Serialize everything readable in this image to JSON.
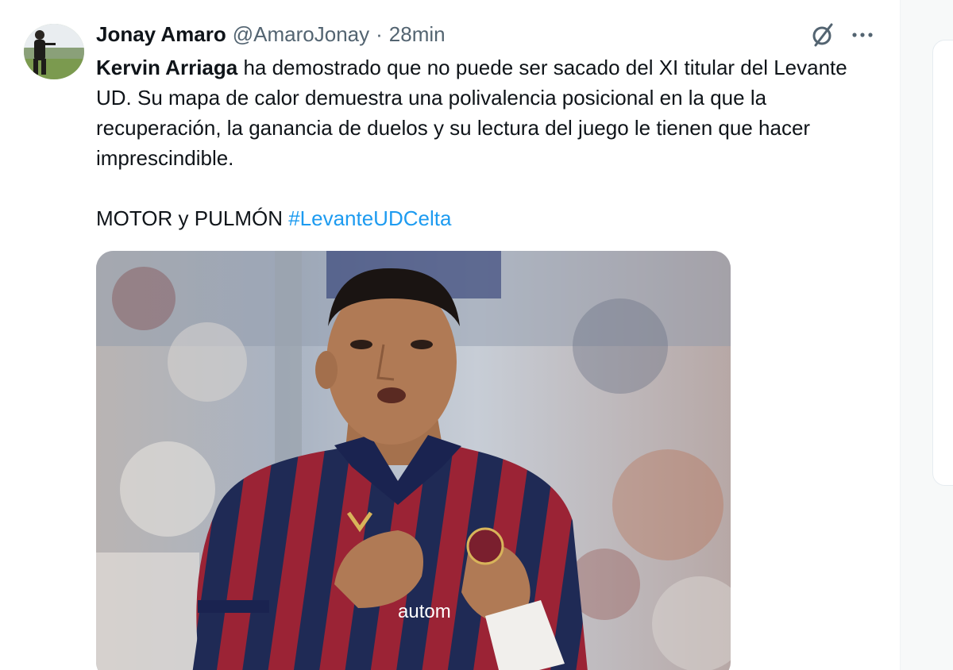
{
  "tweet": {
    "author": {
      "display_name": "Jonay Amaro",
      "handle": "@AmaroJonay",
      "separator": "·",
      "timestamp": "28min"
    },
    "text": {
      "mention": "Kervin Arriaga",
      "body": " ha demostrado que no puede ser sacado del XI titular del Levante UD. Su mapa de calor demuestra una polivalencia posicional  en la que la recuperación, la ganancia de duelos y su lectura del juego le tienen que hacer imprescindible.",
      "line2_text": "MOTOR y PULMÓN ",
      "hashtag": "#LevanteUDCelta"
    },
    "icons": {
      "grok": "grok-slash-circle-icon",
      "more": "more-dots-icon"
    },
    "media": {
      "kind": "photo",
      "jersey_text": "autom"
    }
  },
  "colors": {
    "text_primary": "#0f1419",
    "text_secondary": "#536471",
    "link": "#1d9bf0",
    "jersey_navy": "#1f2a55",
    "jersey_red": "#9b2335"
  }
}
